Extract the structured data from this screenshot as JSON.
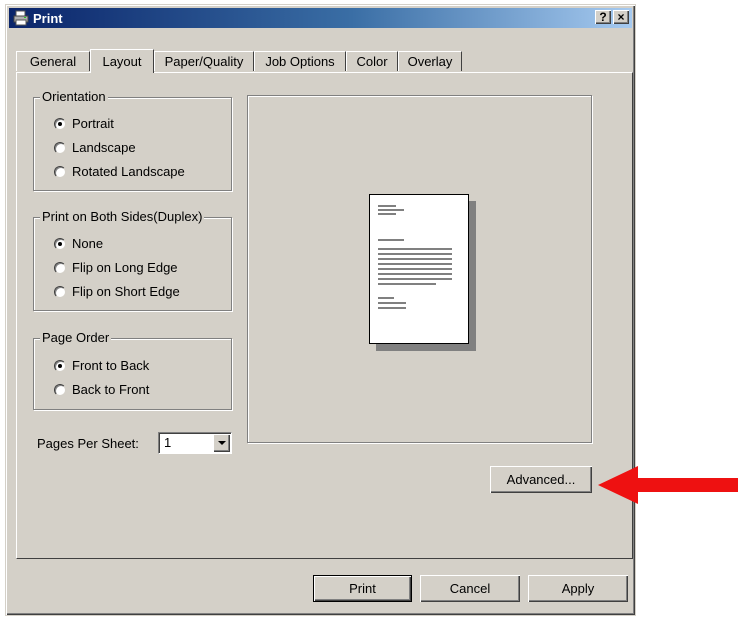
{
  "window": {
    "title": "Print",
    "help_label": "?",
    "close_label": "×"
  },
  "tabs": [
    {
      "label": "General"
    },
    {
      "label": "Layout",
      "active": true
    },
    {
      "label": "Paper/Quality"
    },
    {
      "label": "Job Options"
    },
    {
      "label": "Color"
    },
    {
      "label": "Overlay"
    }
  ],
  "orientation": {
    "legend": "Orientation",
    "options": [
      "Portrait",
      "Landscape",
      "Rotated Landscape"
    ],
    "selected": "Portrait"
  },
  "duplex": {
    "legend": "Print on Both Sides(Duplex)",
    "options": [
      "None",
      "Flip on Long Edge",
      "Flip on Short Edge"
    ],
    "selected": "None"
  },
  "page_order": {
    "legend": "Page Order",
    "options": [
      "Front to Back",
      "Back to Front"
    ],
    "selected": "Front to Back"
  },
  "pages_per_sheet": {
    "label": "Pages Per Sheet:",
    "value": "1"
  },
  "buttons": {
    "advanced": "Advanced...",
    "print": "Print",
    "cancel": "Cancel",
    "apply": "Apply"
  },
  "colors": {
    "title_bar": "#0a246a",
    "face": "#d4d0c8",
    "arrow": "#ee1111"
  }
}
